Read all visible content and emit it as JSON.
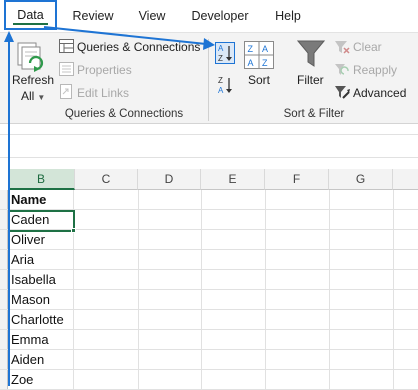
{
  "tabs": [
    {
      "label": "Data",
      "active": true
    },
    {
      "label": "Review"
    },
    {
      "label": "View"
    },
    {
      "label": "Developer"
    },
    {
      "label": "Help"
    }
  ],
  "ribbon": {
    "queries_group": {
      "label": "Queries & Connections",
      "refresh_label": "Refresh",
      "refresh_sub": "All",
      "queries_connections": "Queries & Connections",
      "properties": "Properties",
      "edit_links": "Edit Links"
    },
    "sort_group": {
      "label": "Sort & Filter",
      "sort": "Sort",
      "filter": "Filter",
      "clear": "Clear",
      "reapply": "Reapply",
      "advanced": "Advanced"
    }
  },
  "grid": {
    "columns": [
      "B",
      "C",
      "D",
      "E",
      "F",
      "G"
    ],
    "selected_column": "B",
    "rows": [
      "Name",
      "Caden",
      "Oliver",
      "Aria",
      "Isabella",
      "Mason",
      "Charlotte",
      "Emma",
      "Aiden",
      "Zoe"
    ]
  },
  "colors": {
    "accent_blue": "#1e74d4",
    "excel_green": "#1e7145"
  }
}
